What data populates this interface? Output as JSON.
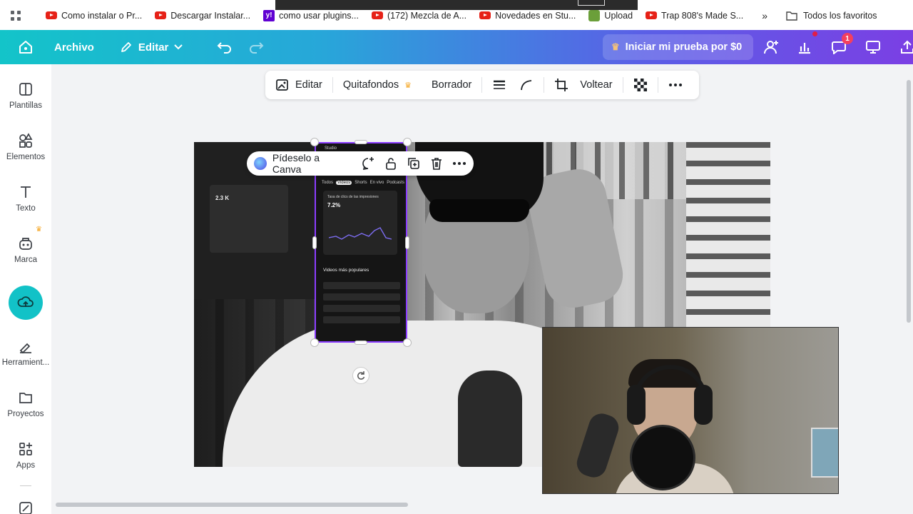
{
  "bookmarks": {
    "items": [
      {
        "label": "Como instalar o Pr...",
        "icon": "youtube-icon"
      },
      {
        "label": "Descargar Instalar...",
        "icon": "youtube-icon"
      },
      {
        "label": "como usar plugins...",
        "icon": "yahoo-icon"
      },
      {
        "label": "(172) Mezcla de A...",
        "icon": "youtube-icon"
      },
      {
        "label": "Novedades en Stu...",
        "icon": "youtube-icon"
      },
      {
        "label": "Upload",
        "icon": "upload-site-icon"
      },
      {
        "label": "Trap 808's Made S...",
        "icon": "youtube-icon"
      }
    ],
    "more": "»",
    "all_favorites": "Todos los favoritos"
  },
  "header": {
    "file": "Archivo",
    "edit": "Editar",
    "trial": "Iniciar mi prueba por $0",
    "comments_badge": "1"
  },
  "sidebar": {
    "items": [
      {
        "label": "Plantillas"
      },
      {
        "label": "Elementos"
      },
      {
        "label": "Texto"
      },
      {
        "label": "Marca"
      },
      {
        "label": "Herramient..."
      },
      {
        "label": "Proyectos"
      },
      {
        "label": "Apps"
      }
    ]
  },
  "toolbar": {
    "edit": "Editar",
    "remove_bg": "Quitafondos",
    "eraser": "Borrador",
    "flip": "Voltear"
  },
  "context_menu": {
    "ask": "Pídeselo a Canva"
  },
  "phone_screenshot": {
    "app": "Studio",
    "tabs": [
      "Todos",
      "Videos",
      "Shorts",
      "En vivo",
      "Podcasts"
    ],
    "metric_label": "Tasa de clics de las impresiones",
    "metric_value": "7.2%",
    "left_metric_value": "2.3 K",
    "popular_title": "Videos más populares"
  },
  "colors": {
    "accent": "#8b3dff",
    "header_start": "#13c4c9",
    "header_end": "#7b3fe4",
    "upload_button": "#12c2c7",
    "crown": "#f5a623"
  }
}
